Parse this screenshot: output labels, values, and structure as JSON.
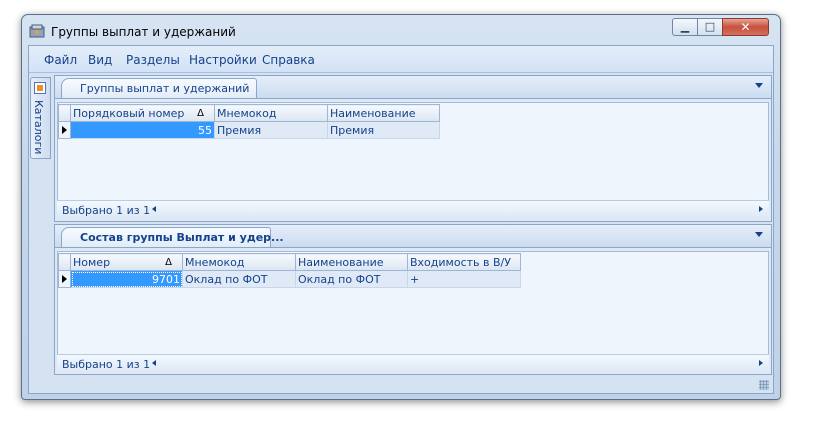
{
  "window": {
    "title": "Группы выплат  и удержаний",
    "min_label": "▁",
    "max_label": "□",
    "close_label": "✕"
  },
  "menu": [
    "Файл",
    "Вид",
    "Разделы",
    "Настройки",
    "Справка"
  ],
  "side_tab": {
    "label": "Каталоги",
    "icon": "catalog-icon"
  },
  "top_panel": {
    "tab_label": "Группы выплат  и удержаний",
    "columns": [
      "Порядковый номер",
      "Мнемокод",
      "Наименование"
    ],
    "sort_indicator": "Δ",
    "rows": [
      [
        "55",
        "Премия",
        "Премия"
      ]
    ],
    "status": "Выбрано 1 из 1"
  },
  "bottom_panel": {
    "tab_label": "Состав группы Выплат и удер...",
    "columns": [
      "Номер",
      "Мнемокод",
      "Наименование",
      "Входимость в В/У"
    ],
    "sort_indicator": "Δ",
    "rows": [
      [
        "9701",
        "Оклад по ФОТ",
        "Оклад по ФОТ",
        "+"
      ]
    ],
    "status": "Выбрано 1 из 1"
  },
  "colors": {
    "accent": "#15428b",
    "selection": "#3399ff",
    "close": "#c7513c"
  }
}
